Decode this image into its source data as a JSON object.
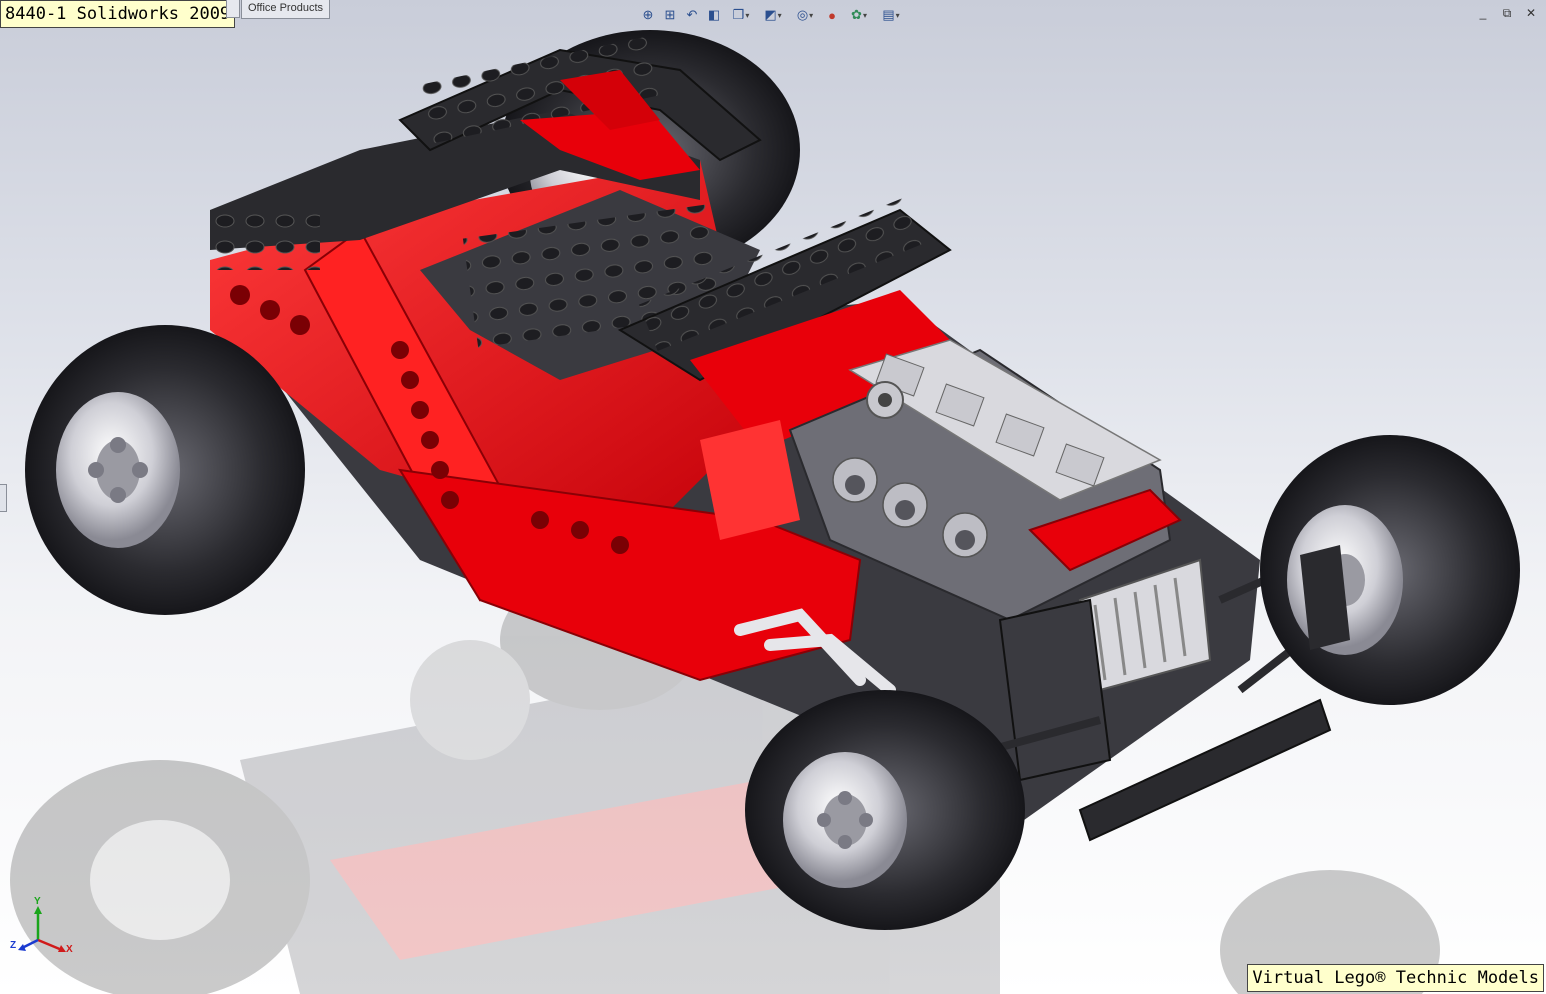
{
  "window": {
    "title": "8440-1 Solidworks 2009",
    "caption": "Virtual Lego® Technic Models"
  },
  "tabs": {
    "active_label": "Office Products"
  },
  "heads_up_toolbar": {
    "items": [
      {
        "id": "zoom-to-fit",
        "icon": "zoom-fit-icon"
      },
      {
        "id": "zoom-to-area",
        "icon": "zoom-area-icon"
      },
      {
        "id": "previous-view",
        "icon": "previous-view-icon"
      },
      {
        "id": "section-view",
        "icon": "section-view-icon"
      },
      {
        "id": "view-orientation",
        "icon": "view-orientation-icon",
        "dropdown": true
      },
      {
        "id": "display-style",
        "icon": "display-style-icon",
        "dropdown": true
      },
      {
        "id": "hide-show-items",
        "icon": "hide-show-icon",
        "dropdown": true
      },
      {
        "id": "edit-appearance",
        "icon": "appearance-icon"
      },
      {
        "id": "apply-scene",
        "icon": "scene-icon",
        "dropdown": true
      },
      {
        "id": "view-settings",
        "icon": "view-settings-icon",
        "dropdown": true
      }
    ]
  },
  "window_controls": {
    "minimize": "_",
    "restore": "⧉",
    "close": "✕"
  },
  "triad": {
    "x_label": "X",
    "y_label": "Y",
    "z_label": "Z"
  },
  "colors": {
    "brick_red": "#e8000a",
    "brick_black": "#2a2a2e",
    "brick_gray": "#5a5a60",
    "rim_silver": "#d8d8de",
    "note_yellow": "#ffffcc"
  }
}
